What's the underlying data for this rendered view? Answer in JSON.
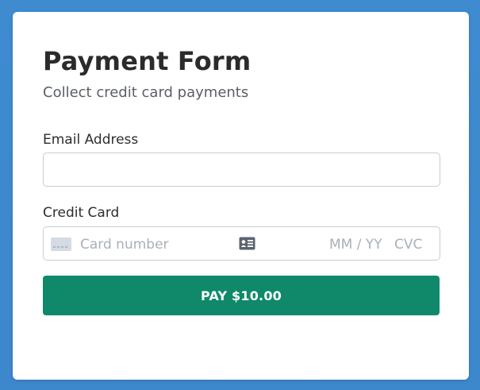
{
  "form": {
    "title": "Payment Form",
    "subtitle": "Collect credit card payments"
  },
  "email": {
    "label": "Email Address",
    "value": "",
    "placeholder": ""
  },
  "credit_card": {
    "label": "Credit Card",
    "number_placeholder": "Card number",
    "expiry_placeholder": "MM / YY",
    "cvc_placeholder": "CVC",
    "card_icon": "credit-card-icon",
    "autofill_icon": "contact-card-icon"
  },
  "pay_button": {
    "label": "PAY $10.00"
  },
  "colors": {
    "background": "#3f8bd0",
    "button": "#10896b",
    "card": "#ffffff"
  }
}
